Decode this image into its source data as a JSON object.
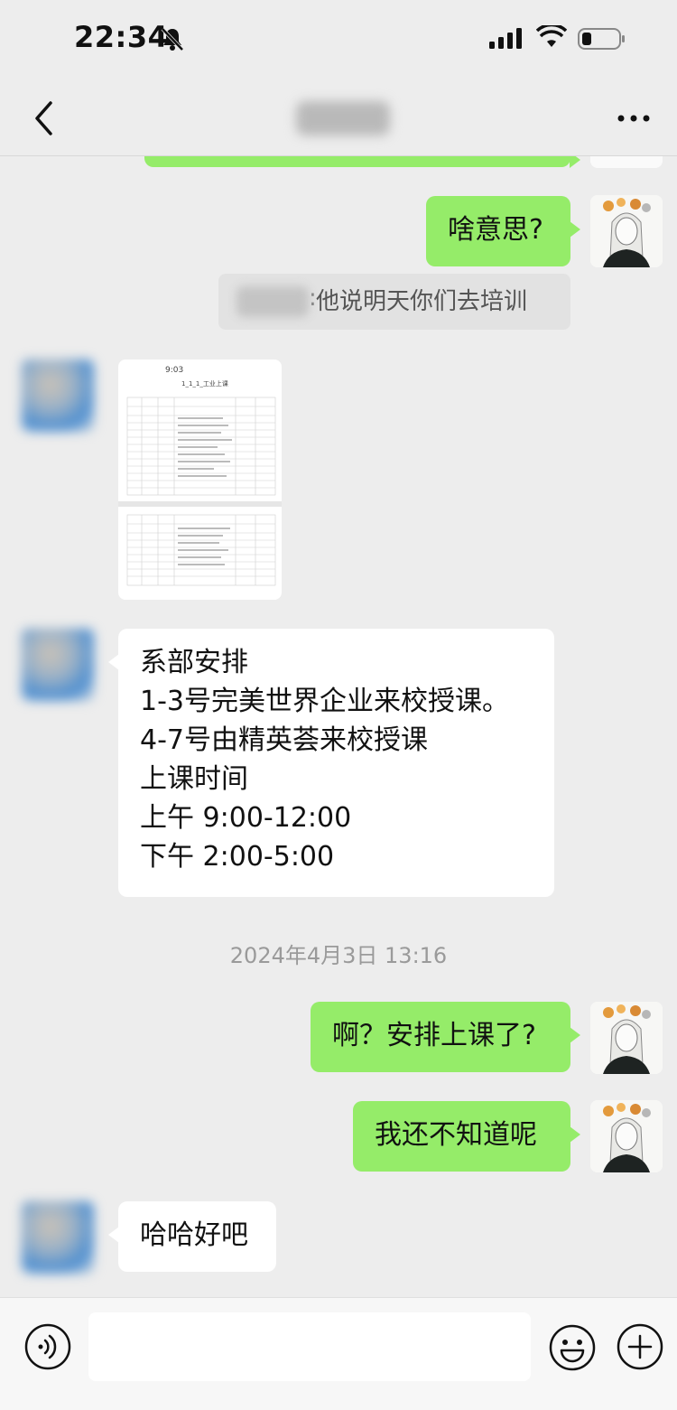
{
  "status_bar": {
    "time": "22:34"
  },
  "messages": {
    "me_1": "啥意思?",
    "quote": "他说明天你们去培训",
    "doc_preview": {
      "time": "9:03",
      "title": "1_1_1_工业上课"
    },
    "other_text": "系部安排\n1-3号完美世界企业来校授课。\n4-7号由精英荟来校授课\n上课时间\n上午 9:00-12:00\n下午 2:00-5:00",
    "timestamp": "2024年4月3日 13:16",
    "me_2": "啊？安排上课了?",
    "me_3": "我还不知道呢",
    "other_last": "哈哈好吧"
  },
  "colors": {
    "me_bubble": "#95ec69",
    "other_bubble": "#ffffff",
    "background": "#ededed"
  },
  "icons": [
    "bell-slash-icon",
    "signal-icon",
    "wifi-icon",
    "battery-icon",
    "back-icon",
    "more-icon",
    "voice-icon",
    "emoji-icon",
    "plus-icon"
  ]
}
